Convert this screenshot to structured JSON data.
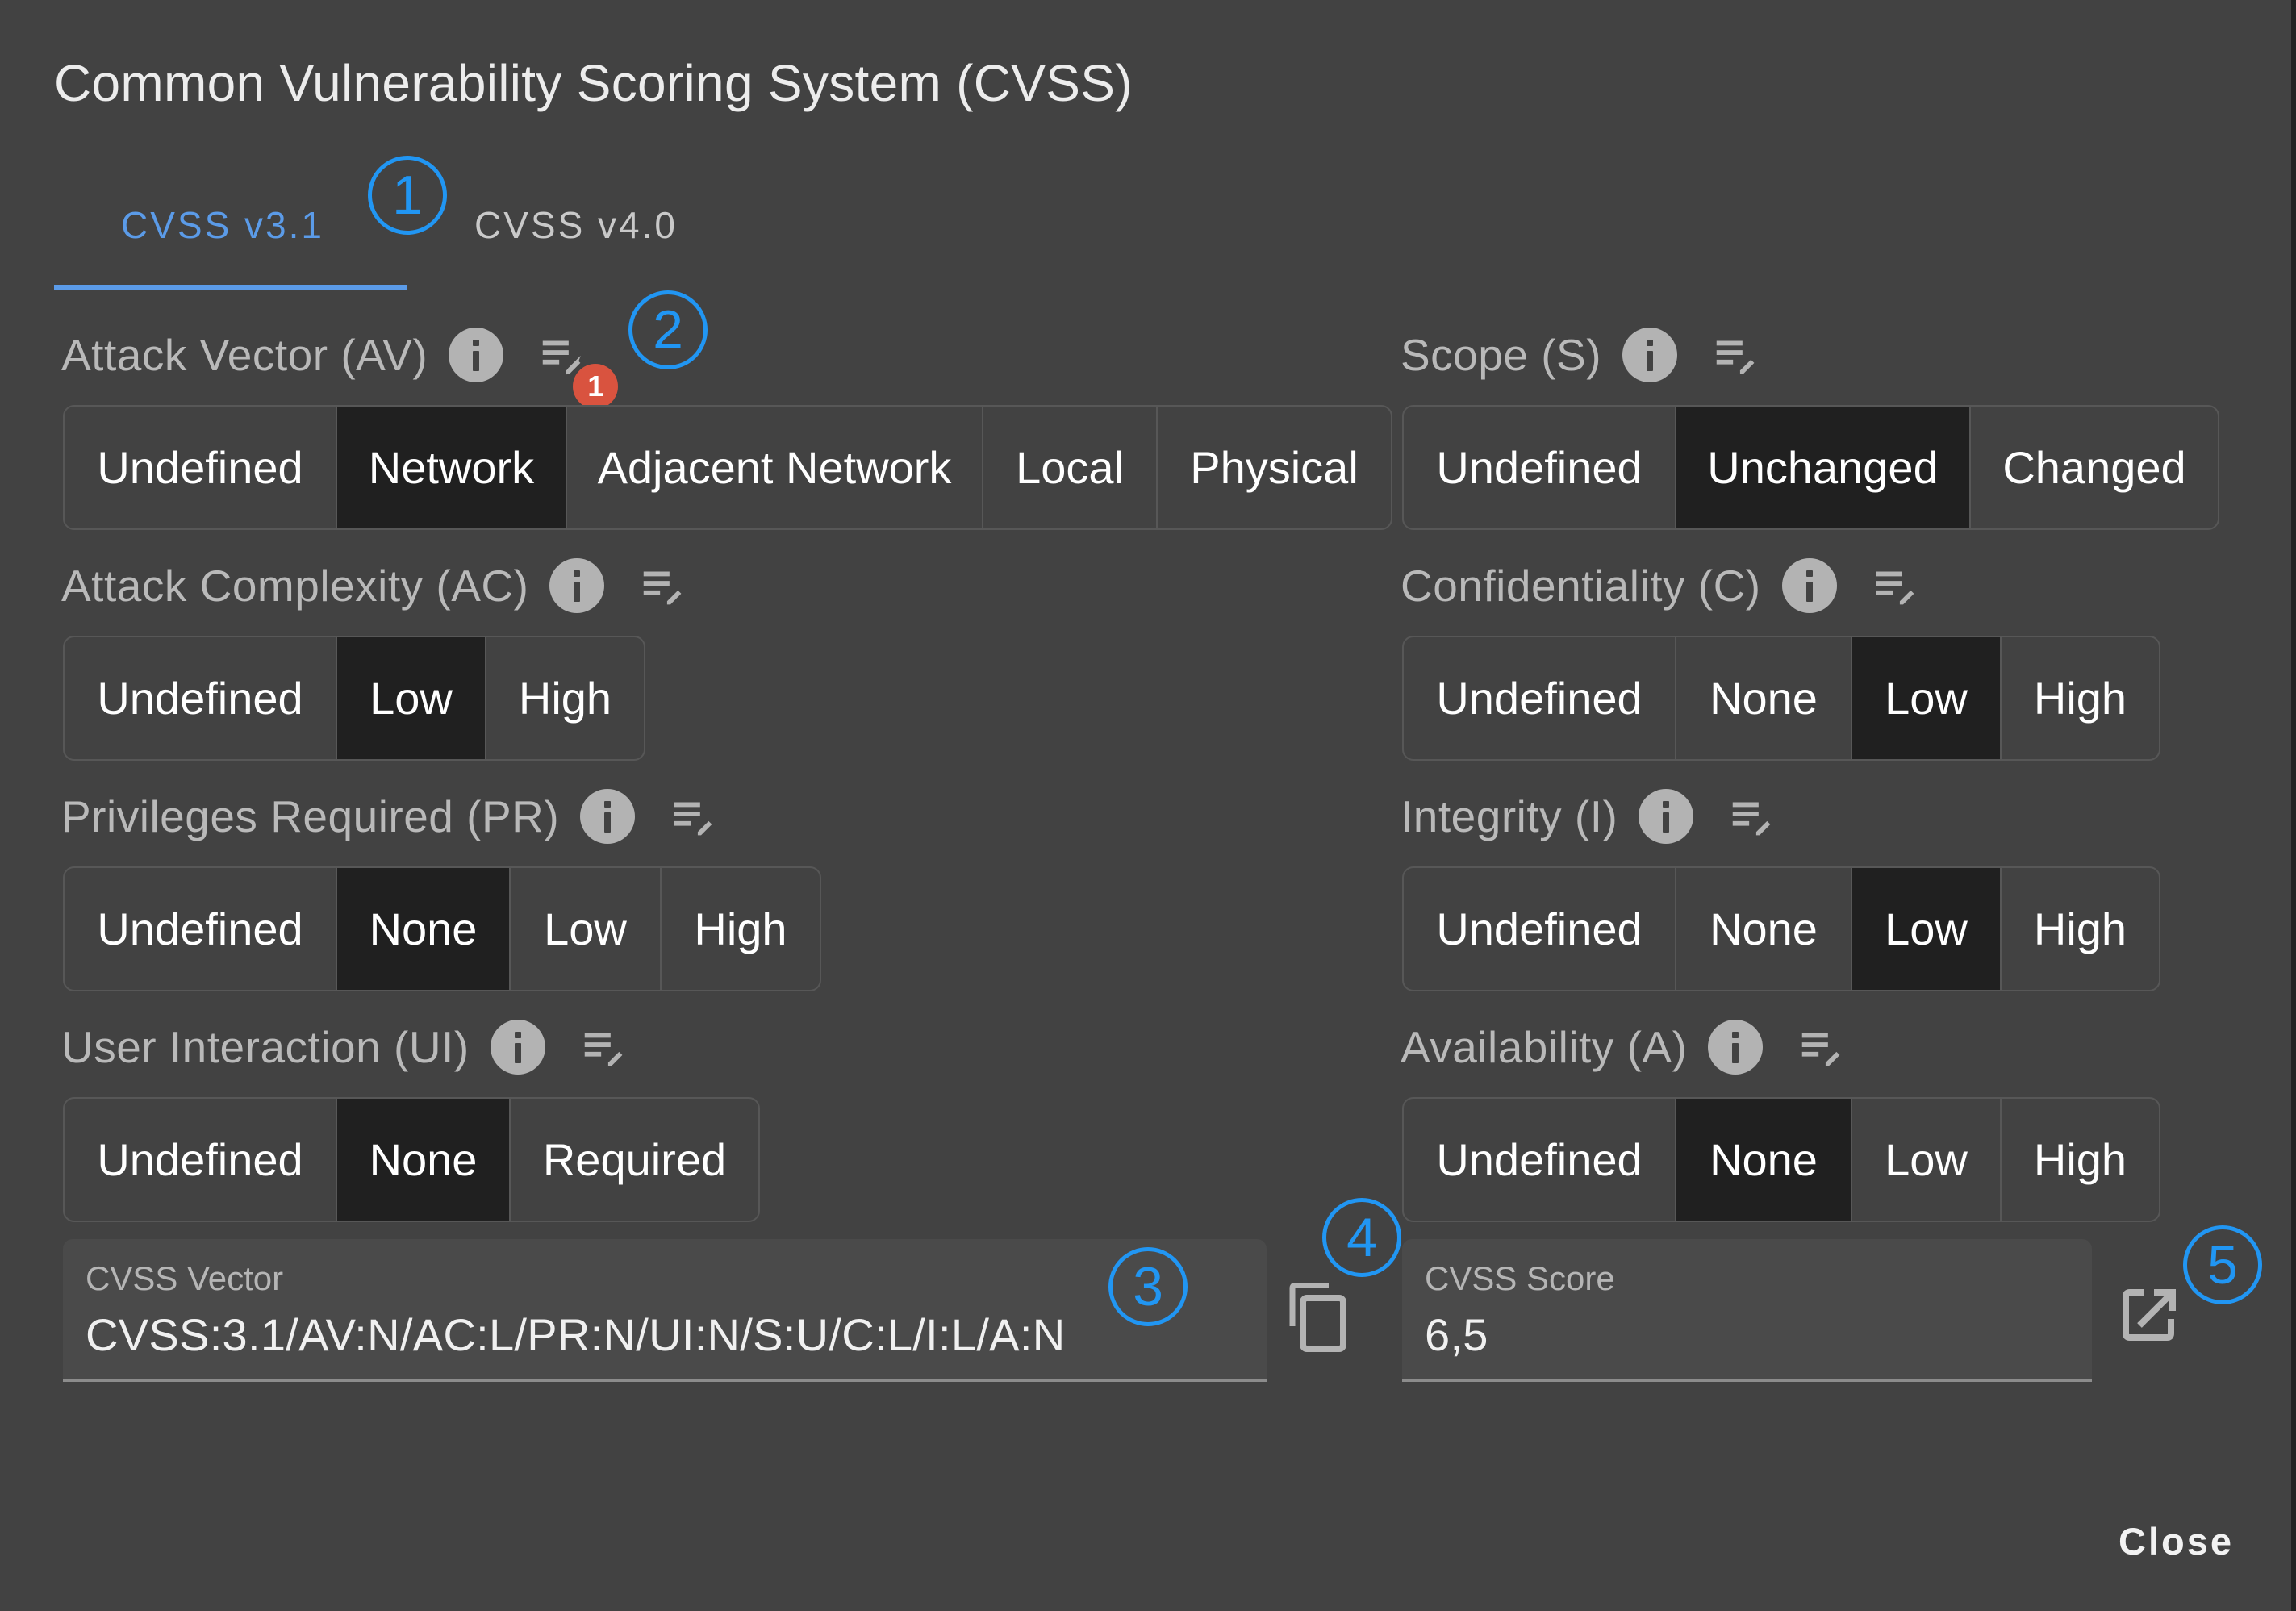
{
  "dialog": {
    "title": "Common Vulnerability Scoring System (CVSS)",
    "close_label": "Close"
  },
  "tabs": [
    {
      "label": "CVSS v3.1",
      "active": true
    },
    {
      "label": "CVSS v4.0",
      "active": false
    }
  ],
  "metrics": {
    "av": {
      "label": "Attack Vector (AV)",
      "notes_badge": "1",
      "options": [
        "Undefined",
        "Network",
        "Adjacent Network",
        "Local",
        "Physical"
      ],
      "selected": "Network"
    },
    "ac": {
      "label": "Attack Complexity (AC)",
      "options": [
        "Undefined",
        "Low",
        "High"
      ],
      "selected": "Low"
    },
    "pr": {
      "label": "Privileges Required (PR)",
      "options": [
        "Undefined",
        "None",
        "Low",
        "High"
      ],
      "selected": "None"
    },
    "ui": {
      "label": "User Interaction (UI)",
      "options": [
        "Undefined",
        "None",
        "Required"
      ],
      "selected": "None"
    },
    "s": {
      "label": "Scope (S)",
      "options": [
        "Undefined",
        "Unchanged",
        "Changed"
      ],
      "selected": "Unchanged"
    },
    "c": {
      "label": "Confidentiality (C)",
      "options": [
        "Undefined",
        "None",
        "Low",
        "High"
      ],
      "selected": "Low"
    },
    "i": {
      "label": "Integrity (I)",
      "options": [
        "Undefined",
        "None",
        "Low",
        "High"
      ],
      "selected": "Low"
    },
    "a": {
      "label": "Availability (A)",
      "options": [
        "Undefined",
        "None",
        "Low",
        "High"
      ],
      "selected": "None"
    }
  },
  "vector_field": {
    "label": "CVSS Vector",
    "value": "CVSS:3.1/AV:N/AC:L/PR:N/UI:N/S:U/C:L/I:L/A:N"
  },
  "score_field": {
    "label": "CVSS Score",
    "value": "6,5"
  },
  "annotations": [
    "1",
    "2",
    "3",
    "4",
    "5"
  ],
  "colors": {
    "accent": "#5b9be8",
    "annotation": "#2196f3",
    "badge": "#d9533f",
    "selected_bg": "#202020",
    "dialog_bg": "#424242"
  }
}
